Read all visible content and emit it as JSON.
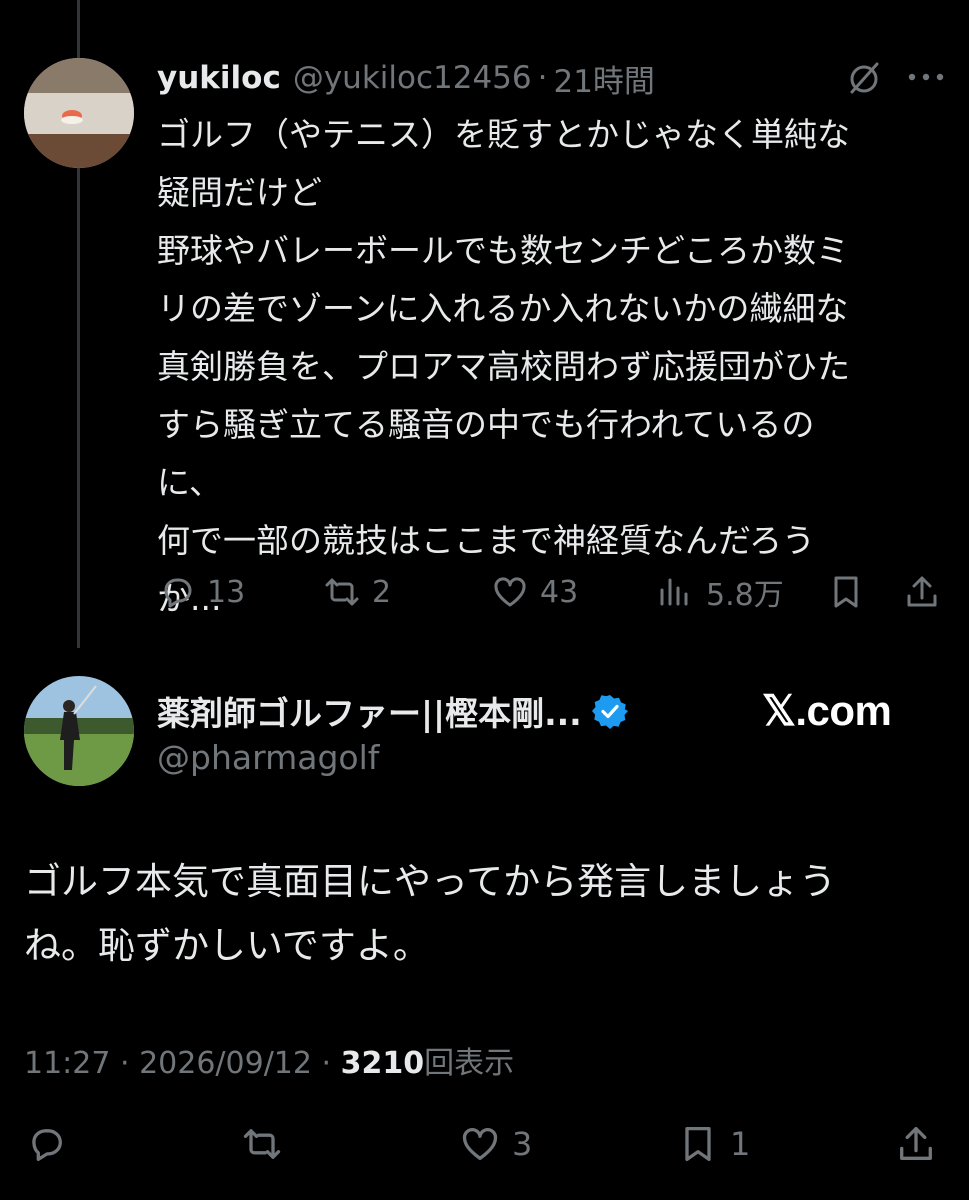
{
  "reply": {
    "display_name": "yukiloc",
    "handle": "@yukiloc12456",
    "separator": "·",
    "time": "21時間",
    "text_lines": [
      "ゴルフ（やテニス）を貶すとかじゃなく単純な",
      "疑問だけど",
      "野球やバレーボールでも数センチどころか数ミ",
      "リの差でゾーンに入れるか入れないかの繊細な",
      "真剣勝負を、プロアマ高校問わず応援団がひた",
      "すら騒ぎ立てる騒音の中でも行われているの",
      "に、",
      "何で一部の競技はここまで神経質なんだろう",
      "か..."
    ],
    "actions": {
      "replies": "13",
      "reposts": "2",
      "likes": "43",
      "views": "5.8万"
    }
  },
  "main": {
    "display_name": "薬剤師ゴルファー||樫本剛...",
    "handle": "@pharmagolf",
    "watermark": "𝕏.com",
    "text_lines": [
      "ゴルフ本気で真面目にやってから発言しましょう",
      "ね。恥ずかしいですよ。"
    ],
    "timestamp": "11:27 · 2026/09/12 · ",
    "views_count": "3210",
    "views_label": "回表示",
    "actions": {
      "replies": "",
      "reposts": "",
      "likes": "3",
      "bookmarks": "1"
    }
  },
  "colors": {
    "background": "#000000",
    "text": "#e7e9ea",
    "muted": "#71767b",
    "verified": "#1d9bf0",
    "thread_line": "#333639"
  },
  "icons": {
    "reply": "speech-bubble-icon",
    "repost": "repost-arrows-icon",
    "like": "heart-icon",
    "views": "bar-chart-icon",
    "bookmark": "bookmark-icon",
    "share": "share-upload-icon",
    "grok": "grok-slash-circle-icon",
    "more": "ellipsis-icon",
    "verified": "verified-badge-icon"
  }
}
